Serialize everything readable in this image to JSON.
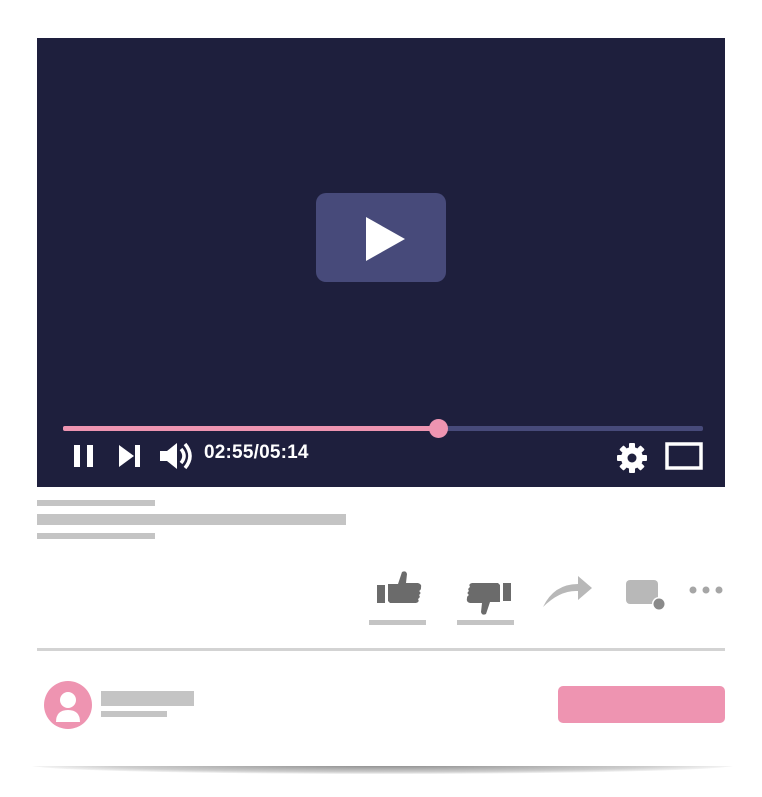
{
  "player": {
    "time_display": "02:55/05:14",
    "progress_fraction": 0.586,
    "colors": {
      "background": "#1e1f3d",
      "accent": "#ee94b1",
      "track": "#474a7a"
    },
    "controls": {
      "big_play_icon": "play-icon",
      "pause_icon": "pause-icon",
      "next_icon": "skip-next-icon",
      "volume_icon": "volume-icon",
      "settings_icon": "gear-icon",
      "fullscreen_icon": "fullscreen-icon"
    }
  },
  "actions": {
    "like_icon": "thumbs-up-icon",
    "dislike_icon": "thumbs-down-icon",
    "share_icon": "share-arrow-icon",
    "save_icon": "comment-icon",
    "more_icon": "more-icon"
  },
  "channel": {
    "avatar_icon": "user-icon"
  }
}
